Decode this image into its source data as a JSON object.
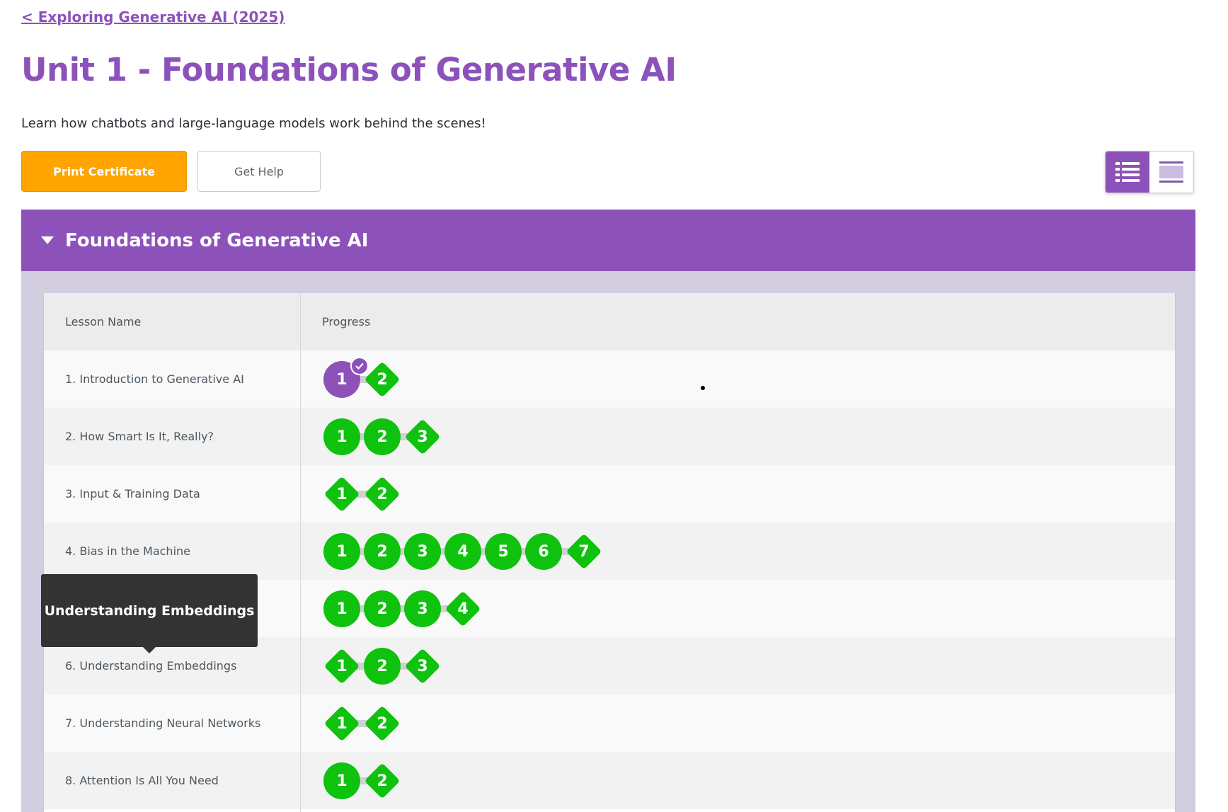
{
  "breadcrumb": {
    "back_label": "< Exploring Generative AI (2025)"
  },
  "page": {
    "title": "Unit 1 - Foundations of Generative AI",
    "description": "Learn how chatbots and large-language models work behind the scenes!"
  },
  "buttons": {
    "print_certificate": "Print Certificate",
    "get_help": "Get Help"
  },
  "view_toggle": {
    "selected": "list-view",
    "options": [
      "list-view",
      "summary-view"
    ]
  },
  "section": {
    "title": "Foundations of Generative AI",
    "expanded": true,
    "columns": {
      "lesson_name": "Lesson Name",
      "progress": "Progress"
    },
    "lessons": [
      {
        "name": "1. Introduction to Generative AI",
        "levels": [
          {
            "label": "1",
            "shape": "circle",
            "status": "completed-purple",
            "checked": true
          },
          {
            "label": "2",
            "shape": "diamond",
            "status": "completed"
          }
        ]
      },
      {
        "name": "2. How Smart Is It, Really?",
        "levels": [
          {
            "label": "1",
            "shape": "circle",
            "status": "completed"
          },
          {
            "label": "2",
            "shape": "circle",
            "status": "completed"
          },
          {
            "label": "3",
            "shape": "diamond",
            "status": "completed"
          }
        ]
      },
      {
        "name": "3. Input & Training Data",
        "levels": [
          {
            "label": "1",
            "shape": "diamond",
            "status": "completed"
          },
          {
            "label": "2",
            "shape": "diamond",
            "status": "completed"
          }
        ]
      },
      {
        "name": "4. Bias in the Machine",
        "levels": [
          {
            "label": "1",
            "shape": "circle",
            "status": "completed"
          },
          {
            "label": "2",
            "shape": "circle",
            "status": "completed"
          },
          {
            "label": "3",
            "shape": "circle",
            "status": "completed"
          },
          {
            "label": "4",
            "shape": "circle",
            "status": "completed"
          },
          {
            "label": "5",
            "shape": "circle",
            "status": "completed"
          },
          {
            "label": "6",
            "shape": "circle",
            "status": "completed"
          },
          {
            "label": "7",
            "shape": "diamond",
            "status": "completed"
          }
        ]
      },
      {
        "name": "",
        "levels": [
          {
            "label": "1",
            "shape": "circle",
            "status": "completed"
          },
          {
            "label": "2",
            "shape": "circle",
            "status": "completed"
          },
          {
            "label": "3",
            "shape": "circle",
            "status": "completed"
          },
          {
            "label": "4",
            "shape": "diamond",
            "status": "completed"
          }
        ]
      },
      {
        "name": "6. Understanding Embeddings",
        "levels": [
          {
            "label": "1",
            "shape": "diamond",
            "status": "completed"
          },
          {
            "label": "2",
            "shape": "circle",
            "status": "completed"
          },
          {
            "label": "3",
            "shape": "diamond",
            "status": "completed"
          }
        ]
      },
      {
        "name": "7. Understanding Neural Networks",
        "levels": [
          {
            "label": "1",
            "shape": "diamond",
            "status": "completed"
          },
          {
            "label": "2",
            "shape": "diamond",
            "status": "completed"
          }
        ]
      },
      {
        "name": "8. Attention Is All You Need",
        "levels": [
          {
            "label": "1",
            "shape": "circle",
            "status": "completed"
          },
          {
            "label": "2",
            "shape": "diamond",
            "status": "completed"
          }
        ]
      }
    ]
  },
  "tooltip": {
    "text": "Understanding Embeddings"
  },
  "colors": {
    "accent": "#8c52ba",
    "completed": "#0ec20e",
    "certificate": "#ffa400",
    "section_body": "#d3cde0"
  },
  "icons": {
    "list_view": "list-icon",
    "summary_view": "summary-icon",
    "collapse": "caret-down-icon",
    "check": "check-icon"
  }
}
